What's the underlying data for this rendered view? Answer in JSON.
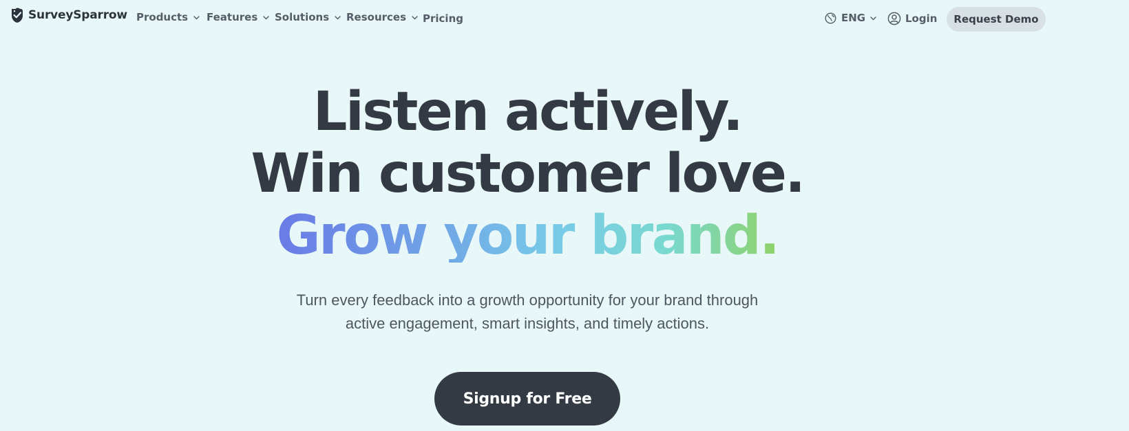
{
  "brand": {
    "name": "SurveySparrow"
  },
  "nav": {
    "items": [
      {
        "label": "Products",
        "has_dropdown": true
      },
      {
        "label": "Features",
        "has_dropdown": true
      },
      {
        "label": "Solutions",
        "has_dropdown": true
      },
      {
        "label": "Resources",
        "has_dropdown": true
      },
      {
        "label": "Pricing",
        "has_dropdown": false
      }
    ],
    "language": "ENG",
    "login": "Login",
    "request_demo": "Request Demo"
  },
  "hero": {
    "line1": "Listen actively.",
    "line2": "Win customer love.",
    "line3": "Grow your brand.",
    "subtitle_line1": "Turn every feedback into a growth opportunity for your brand through",
    "subtitle_line2": "active engagement, smart insights, and timely actions.",
    "cta": "Signup for Free"
  },
  "colors": {
    "background": "#e8f7f8",
    "text_dark": "#343a43",
    "nav_text": "#555d68",
    "demo_button_bg": "#d7e0e4",
    "cta_bg": "#343a43",
    "gradient": [
      "#6a7ae6",
      "#6fa2e6",
      "#78cae8",
      "#79d9cf",
      "#8fd268"
    ]
  },
  "icons": {
    "logo": "sparrow-logo-icon",
    "dropdown": "chevron-down-icon",
    "language": "globe-icon",
    "login": "user-circle-icon"
  }
}
